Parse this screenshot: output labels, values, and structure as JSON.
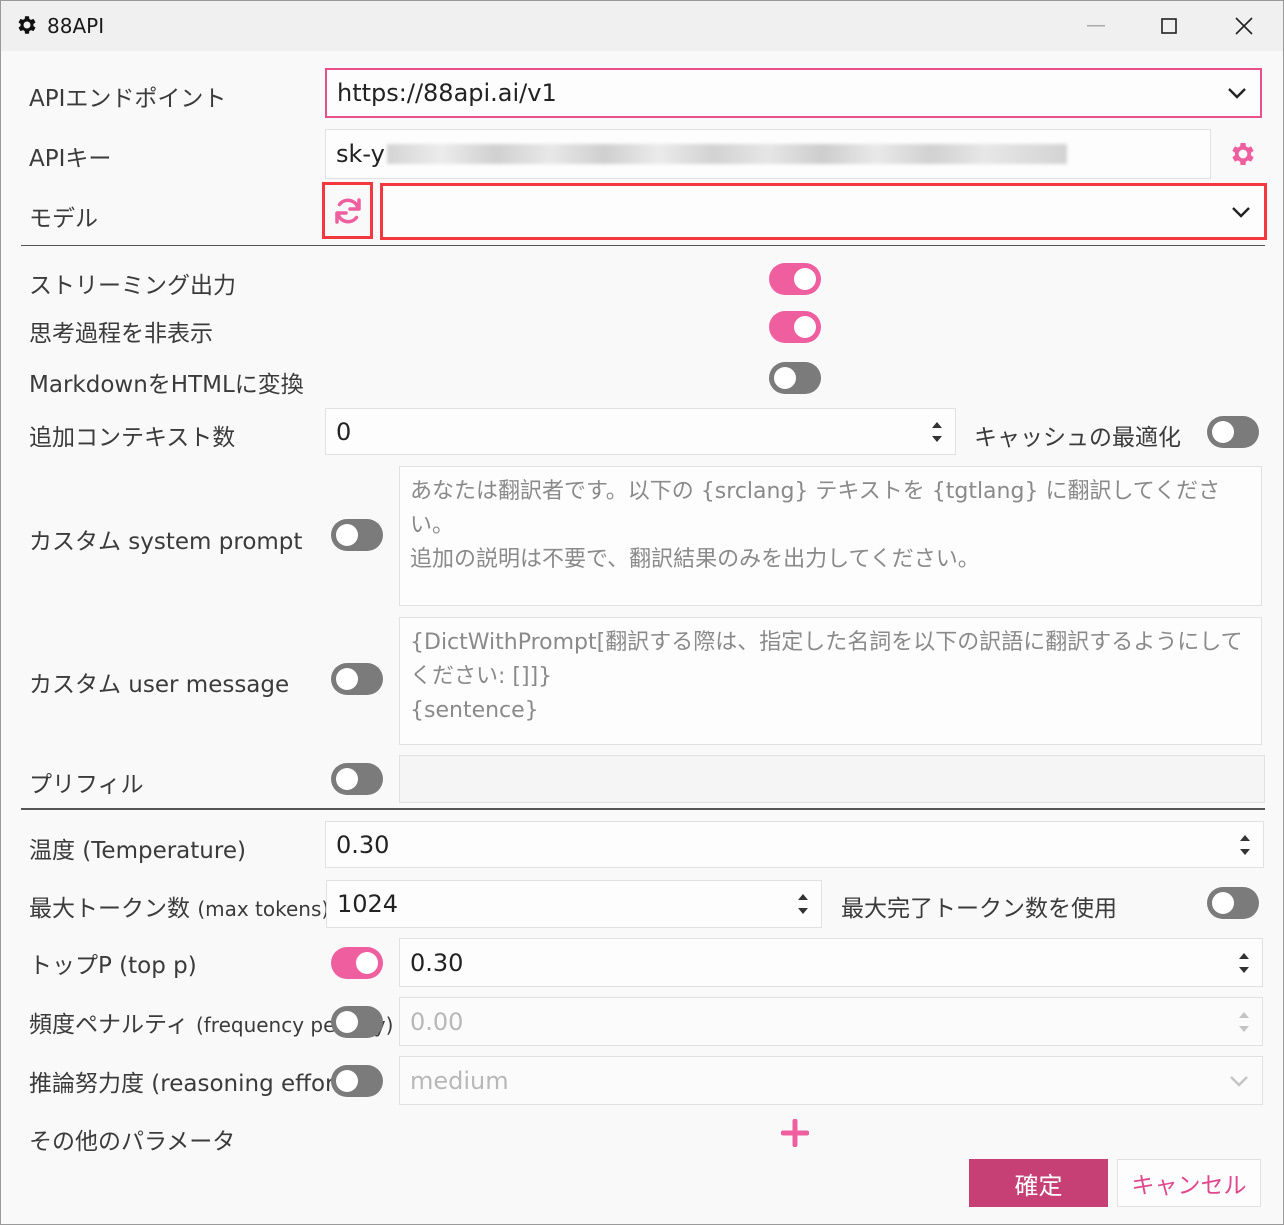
{
  "window": {
    "title": "88API",
    "icon": "gear-icon",
    "controls": [
      "minimize-icon",
      "maximize-icon",
      "close-icon"
    ]
  },
  "api": {
    "endpoint_label": "APIエンドポイント",
    "endpoint_value": "https://88api.ai/v1",
    "key_label": "APIキー",
    "key_value_visible": "sk-y",
    "model_label": "モデル",
    "model_value": ""
  },
  "toggles": {
    "streaming_label": "ストリーミング出力",
    "streaming_on": true,
    "hide_thinking_label": "思考過程を非表示",
    "hide_thinking_on": true,
    "markdown_label": "MarkdownをHTMLに変換",
    "markdown_on": false
  },
  "context": {
    "label": "追加コンテキスト数",
    "value": "0",
    "cache_label": "キャッシュの最適化",
    "cache_on": false
  },
  "system_prompt": {
    "label": "カスタム system prompt",
    "enabled": false,
    "placeholder": "あなたは翻訳者です。以下の {srclang} テキストを {tgtlang} に翻訳してください。\n追加の説明は不要で、翻訳結果のみを出力してください。"
  },
  "user_message": {
    "label": "カスタム user message",
    "enabled": false,
    "placeholder": "{DictWithPrompt[翻訳する際は、指定した名詞を以下の訳語に翻訳するようにしてください: []]}\n{sentence}"
  },
  "prefill": {
    "label": "プリフィル",
    "enabled": false,
    "value": ""
  },
  "params": {
    "temperature_label": "温度 (Temperature)",
    "temperature_value": "0.30",
    "max_tokens_label": "最大トークン数",
    "max_tokens_sub": "(max tokens)",
    "max_tokens_value": "1024",
    "max_completion_label": "最大完了トークン数を使用",
    "max_completion_on": false,
    "top_p_label": "トップP (top p)",
    "top_p_on": true,
    "top_p_value": "0.30",
    "freq_label": "頻度ペナルティ",
    "freq_sub": "(frequency penalty)",
    "freq_on": false,
    "freq_value": "0.00",
    "reasoning_label": "推論努力度 (reasoning effort)",
    "reasoning_on": false,
    "reasoning_value": "medium",
    "other_label": "その他のパラメータ"
  },
  "buttons": {
    "ok": "確定",
    "cancel": "キャンセル"
  },
  "colors": {
    "accent": "#ef5fa0",
    "accent_dark": "#c64075",
    "highlight_red": "#f33840"
  }
}
